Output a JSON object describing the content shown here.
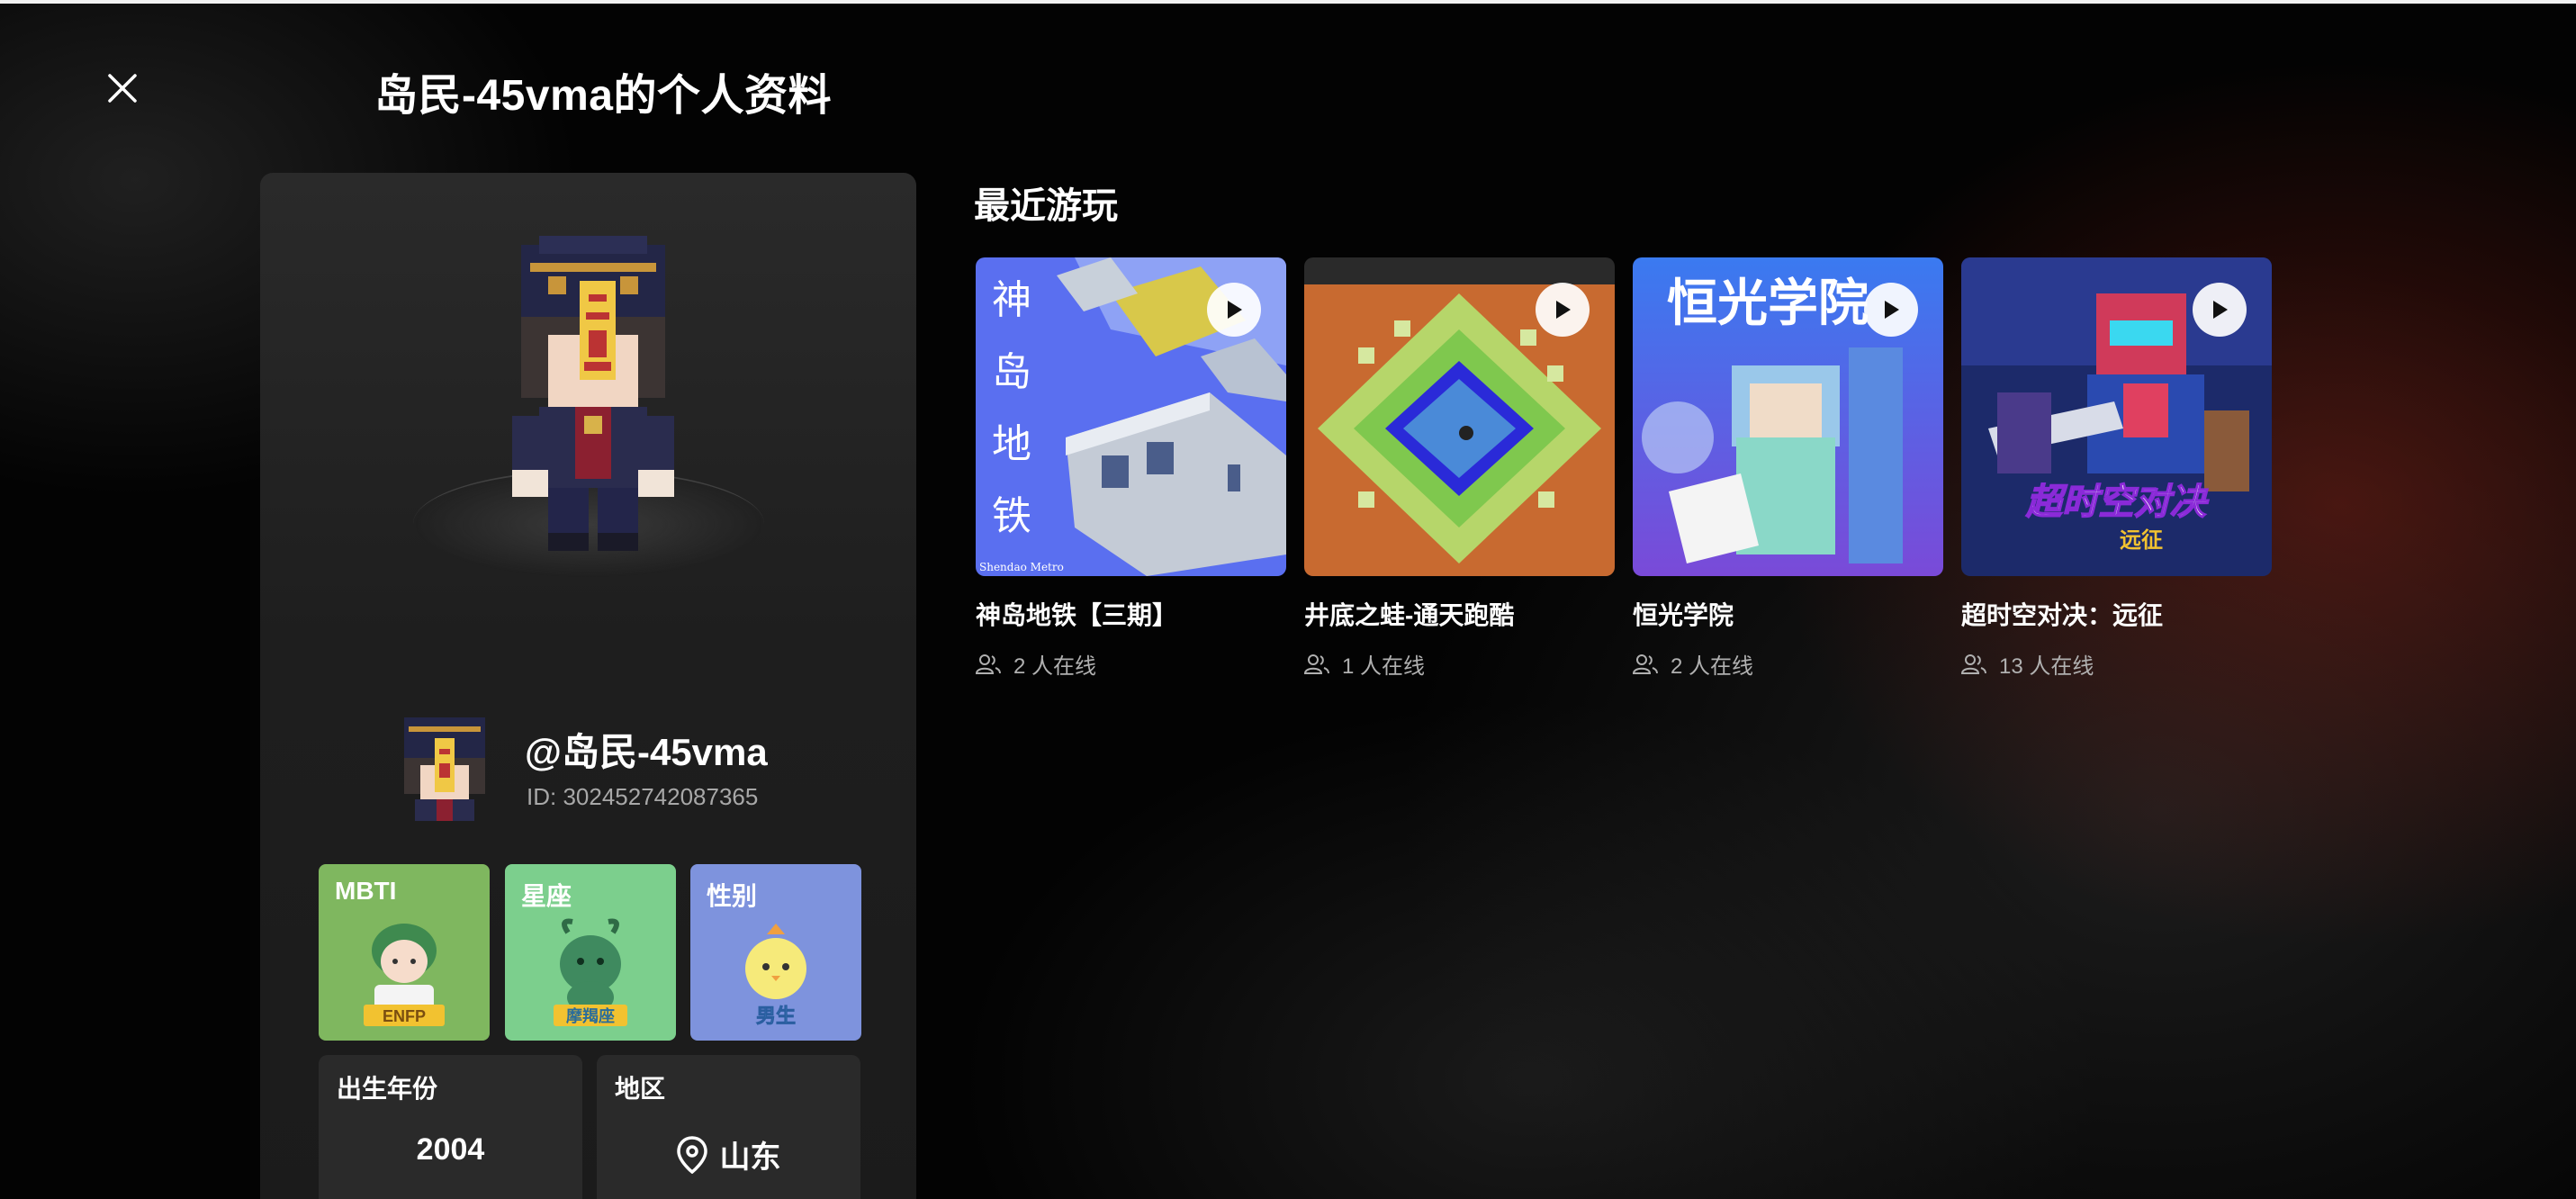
{
  "header": {
    "title": "岛民-45vma的个人资料"
  },
  "profile": {
    "username": "@岛民-45vma",
    "user_id": "ID: 302452742087365",
    "tags": [
      {
        "label": "MBTI",
        "badge": "ENFP",
        "color": "#7fb75f"
      },
      {
        "label": "星座",
        "badge": "摩羯座",
        "color": "#7ccf8d"
      },
      {
        "label": "性别",
        "badge": "男生",
        "color": "#7e93dd"
      }
    ],
    "birth_year": {
      "label": "出生年份",
      "value": "2004"
    },
    "region": {
      "label": "地区",
      "value": "山东",
      "icon": "location-pin-icon"
    }
  },
  "recent": {
    "title": "最近游玩",
    "games": [
      {
        "name": "神岛地铁【三期】",
        "online": "2 人在线",
        "thumb_text": [
          "神",
          "岛",
          "地",
          "铁"
        ],
        "thumb_caption": "Shendao Metro"
      },
      {
        "name": "井底之蛙-通天跑酷",
        "online": "1 人在线"
      },
      {
        "name": "恒光学院",
        "online": "2 人在线",
        "thumb_text": [
          "恒光学院"
        ]
      },
      {
        "name": "超时空对决：远征",
        "online": "13 人在线",
        "thumb_text": [
          "超时空对决",
          "远征"
        ]
      }
    ]
  }
}
